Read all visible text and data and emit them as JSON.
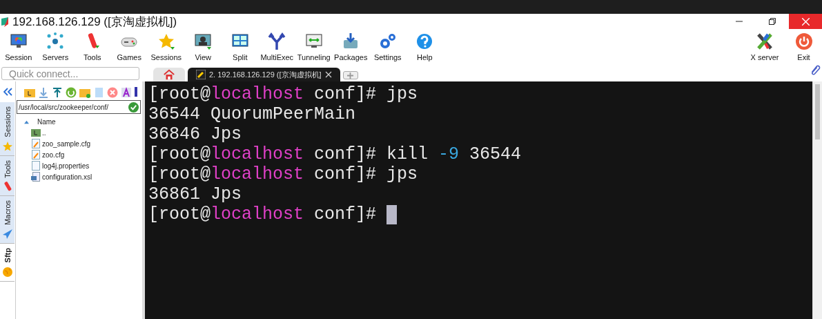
{
  "window": {
    "title": "192.168.126.129 ([京淘虚拟机])"
  },
  "toolbar": {
    "buttons": [
      {
        "label": "Session"
      },
      {
        "label": "Servers"
      },
      {
        "label": "Tools"
      },
      {
        "label": "Games"
      },
      {
        "label": "Sessions"
      },
      {
        "label": "View"
      },
      {
        "label": "Split"
      },
      {
        "label": "MultiExec"
      },
      {
        "label": "Tunneling"
      },
      {
        "label": "Packages"
      },
      {
        "label": "Settings"
      },
      {
        "label": "Help"
      }
    ],
    "right_buttons": [
      {
        "label": "X server"
      },
      {
        "label": "Exit"
      }
    ]
  },
  "quick_connect": {
    "placeholder": "Quick connect..."
  },
  "tabs": [
    {
      "kind": "home",
      "selected": false
    },
    {
      "kind": "session",
      "label": "2. 192.168.126.129 ([京淘虚拟机]",
      "selected": true
    }
  ],
  "side_tabs": [
    {
      "label": "Sessions",
      "selected": false
    },
    {
      "label": "Tools",
      "selected": false
    },
    {
      "label": "Macros",
      "selected": false
    },
    {
      "label": "Sftp",
      "selected": true
    }
  ],
  "sftp": {
    "path": "/usr/local/src/zookeeper/conf/",
    "column": "Name",
    "files": [
      {
        "name": "..",
        "kind": "parent"
      },
      {
        "name": "zoo_sample.cfg",
        "kind": "edited"
      },
      {
        "name": "zoo.cfg",
        "kind": "edited"
      },
      {
        "name": "log4j.properties",
        "kind": "file"
      },
      {
        "name": "configuration.xsl",
        "kind": "xsl"
      }
    ]
  },
  "terminal": {
    "lines": [
      {
        "segments": [
          {
            "text": "[root@",
            "kind": "plain"
          },
          {
            "text": "localhost",
            "kind": "host"
          },
          {
            "text": " conf]# jps",
            "kind": "plain"
          }
        ]
      },
      {
        "segments": [
          {
            "text": "36544 QuorumPeerMain",
            "kind": "plain"
          }
        ]
      },
      {
        "segments": [
          {
            "text": "36846 Jps",
            "kind": "plain"
          }
        ]
      },
      {
        "segments": [
          {
            "text": "[root@",
            "kind": "plain"
          },
          {
            "text": "localhost",
            "kind": "host"
          },
          {
            "text": " conf]# kill ",
            "kind": "plain"
          },
          {
            "text": "-9",
            "kind": "option"
          },
          {
            "text": " 36544",
            "kind": "plain"
          }
        ]
      },
      {
        "segments": [
          {
            "text": "[root@",
            "kind": "plain"
          },
          {
            "text": "localhost",
            "kind": "host"
          },
          {
            "text": " conf]# jps",
            "kind": "plain"
          }
        ]
      },
      {
        "segments": [
          {
            "text": "36861 Jps",
            "kind": "plain"
          }
        ]
      },
      {
        "segments": [
          {
            "text": "[root@",
            "kind": "plain"
          },
          {
            "text": "localhost",
            "kind": "host"
          },
          {
            "text": " conf]# ",
            "kind": "plain"
          }
        ],
        "cursor": true
      }
    ]
  }
}
